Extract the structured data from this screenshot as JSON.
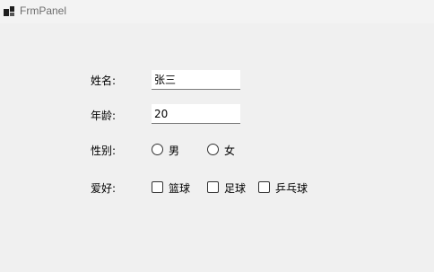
{
  "window": {
    "title": "FrmPanel"
  },
  "form": {
    "name_label": "姓名:",
    "name_value": "张三",
    "age_label": "年龄:",
    "age_value": "20",
    "gender_label": "性别:",
    "gender_options": [
      "男",
      "女"
    ],
    "hobby_label": "爱好:",
    "hobby_options": [
      "篮球",
      "足球",
      "乒乓球"
    ]
  }
}
